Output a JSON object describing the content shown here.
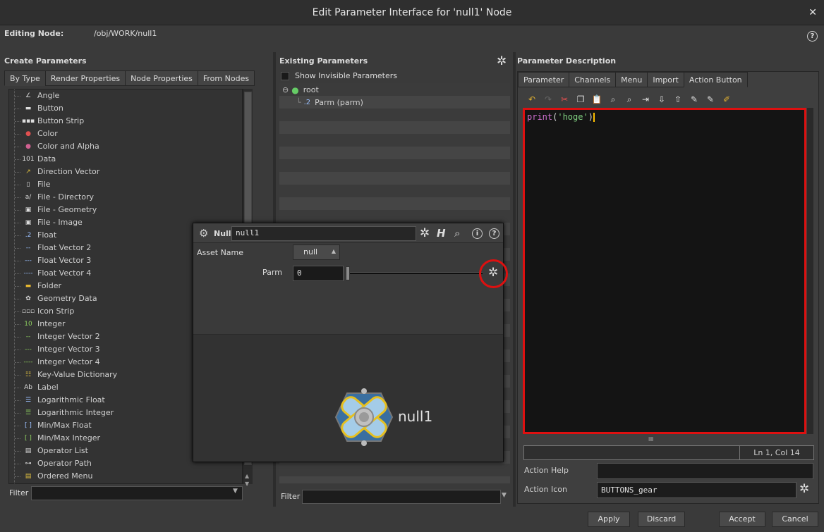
{
  "window": {
    "title": "Edit Parameter Interface for 'null1' Node",
    "close_glyph": "✕"
  },
  "editing": {
    "label": "Editing Node:",
    "path": "/obj/WORK/null1",
    "help": "?"
  },
  "create": {
    "title": "Create Parameters",
    "tabs": [
      "By Type",
      "Render Properties",
      "Node Properties",
      "From Nodes"
    ],
    "items": [
      {
        "label": "Angle",
        "icon": "angle-icon",
        "glyph": "∠",
        "color": "#dddddd"
      },
      {
        "label": "Button",
        "icon": "button-icon",
        "glyph": "▬",
        "color": "#dddddd"
      },
      {
        "label": "Button Strip",
        "icon": "button-strip-icon",
        "glyph": "▪▪▪",
        "color": "#dddddd"
      },
      {
        "label": "Color",
        "icon": "color-icon",
        "glyph": "●",
        "color": "#e05050"
      },
      {
        "label": "Color and Alpha",
        "icon": "color-alpha-icon",
        "glyph": "●",
        "color": "#d06090"
      },
      {
        "label": "Data",
        "icon": "data-icon",
        "glyph": "101",
        "color": "#dddddd"
      },
      {
        "label": "Direction Vector",
        "icon": "direction-vector-icon",
        "glyph": "↗",
        "color": "#e0c040"
      },
      {
        "label": "File",
        "icon": "file-icon",
        "glyph": "▯",
        "color": "#dddddd"
      },
      {
        "label": "File - Directory",
        "icon": "file-directory-icon",
        "glyph": "a/",
        "color": "#dddddd"
      },
      {
        "label": "File - Geometry",
        "icon": "file-geometry-icon",
        "glyph": "▣",
        "color": "#dddddd"
      },
      {
        "label": "File - Image",
        "icon": "file-image-icon",
        "glyph": "▣",
        "color": "#dddddd"
      },
      {
        "label": "Float",
        "icon": "float-icon",
        "glyph": ".2",
        "color": "#9bc0ff"
      },
      {
        "label": "Float Vector 2",
        "icon": "float-vector2-icon",
        "glyph": "--",
        "color": "#9bc0ff"
      },
      {
        "label": "Float Vector 3",
        "icon": "float-vector3-icon",
        "glyph": "---",
        "color": "#9bc0ff"
      },
      {
        "label": "Float Vector 4",
        "icon": "float-vector4-icon",
        "glyph": "----",
        "color": "#9bc0ff"
      },
      {
        "label": "Folder",
        "icon": "folder-icon",
        "glyph": "▬",
        "color": "#e8b830"
      },
      {
        "label": "Geometry Data",
        "icon": "geometry-data-icon",
        "glyph": "✿",
        "color": "#dddddd"
      },
      {
        "label": "Icon Strip",
        "icon": "icon-strip-icon",
        "glyph": "▫▫▫",
        "color": "#dddddd"
      },
      {
        "label": "Integer",
        "icon": "integer-icon",
        "glyph": "10",
        "color": "#8fd060"
      },
      {
        "label": "Integer Vector 2",
        "icon": "integer-vector2-icon",
        "glyph": "--",
        "color": "#8fd060"
      },
      {
        "label": "Integer Vector 3",
        "icon": "integer-vector3-icon",
        "glyph": "---",
        "color": "#8fd060"
      },
      {
        "label": "Integer Vector 4",
        "icon": "integer-vector4-icon",
        "glyph": "----",
        "color": "#8fd060"
      },
      {
        "label": "Key-Value Dictionary",
        "icon": "key-value-icon",
        "glyph": "☷",
        "color": "#e0c040"
      },
      {
        "label": "Label",
        "icon": "label-icon",
        "glyph": "Ab",
        "color": "#dddddd"
      },
      {
        "label": "Logarithmic Float",
        "icon": "log-float-icon",
        "glyph": "☰",
        "color": "#9bc0ff"
      },
      {
        "label": "Logarithmic Integer",
        "icon": "log-integer-icon",
        "glyph": "☰",
        "color": "#8fd060"
      },
      {
        "label": "Min/Max Float",
        "icon": "minmax-float-icon",
        "glyph": "[ ]",
        "color": "#9bc0ff"
      },
      {
        "label": "Min/Max Integer",
        "icon": "minmax-integer-icon",
        "glyph": "[ ]",
        "color": "#8fd060"
      },
      {
        "label": "Operator List",
        "icon": "operator-list-icon",
        "glyph": "▤",
        "color": "#dddddd"
      },
      {
        "label": "Operator Path",
        "icon": "operator-path-icon",
        "glyph": "⊶",
        "color": "#dddddd"
      },
      {
        "label": "Ordered Menu",
        "icon": "ordered-menu-icon",
        "glyph": "▤",
        "color": "#e0c040"
      }
    ],
    "filter_label": "Filter",
    "filter_value": ""
  },
  "existing": {
    "title": "Existing Parameters",
    "show_invisible": "Show Invisible Parameters",
    "root": "root",
    "parm": "Parm (parm)",
    "filter_label": "Filter",
    "filter_value": ""
  },
  "description": {
    "title": "Parameter Description",
    "tabs": [
      "Parameter",
      "Channels",
      "Menu",
      "Import",
      "Action Button"
    ],
    "code": {
      "func": "print",
      "open": "(",
      "string": "'hoge'",
      "close": ")"
    },
    "status": "Ln 1, Col 14",
    "action_help_label": "Action Help",
    "action_help_value": "",
    "action_icon_label": "Action Icon",
    "action_icon_value": "BUTTONS_gear"
  },
  "overlay": {
    "node_type": "Null",
    "node_name": "null1",
    "asset_name_label": "Asset Name",
    "asset_value": "null",
    "parm_label": "Parm",
    "parm_value": "0",
    "preview_name": "null1",
    "slider_fraction": 0.0
  },
  "footer": {
    "apply": "Apply",
    "discard": "Discard",
    "accept": "Accept",
    "cancel": "Cancel"
  },
  "colors": {
    "highlight": "#dd1010",
    "code_func": "#d070d0",
    "code_string": "#80d080",
    "cursor": "#ffc000"
  }
}
